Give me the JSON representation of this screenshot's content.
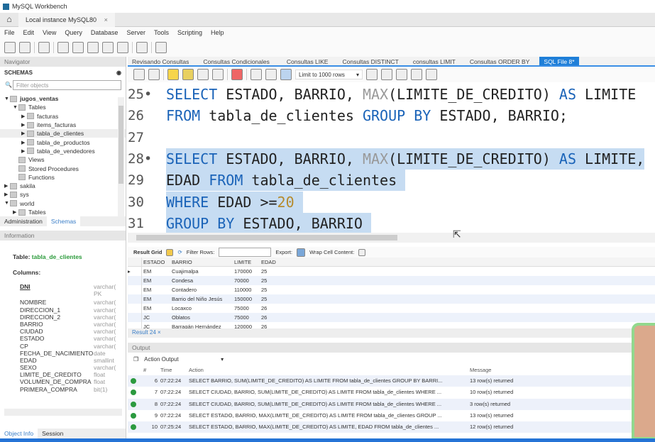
{
  "window": {
    "title": "MySQL Workbench",
    "connection_tab": "Local instance MySQL80",
    "close": "×",
    "home": "⌂"
  },
  "menu": [
    "File",
    "Edit",
    "View",
    "Query",
    "Database",
    "Server",
    "Tools",
    "Scripting",
    "Help"
  ],
  "navigator": {
    "header": "Navigator",
    "schemas_title": "SCHEMAS",
    "filter_placeholder": "Filter objects",
    "tree": [
      {
        "label": "jugos_ventas",
        "level": 0,
        "arrow": "▼",
        "bold": true
      },
      {
        "label": "Tables",
        "level": 1,
        "arrow": "▼"
      },
      {
        "label": "facturas",
        "level": 2,
        "arrow": "▶"
      },
      {
        "label": "items_facturas",
        "level": 2,
        "arrow": "▶"
      },
      {
        "label": "tabla_de_clientes",
        "level": 2,
        "arrow": "▶",
        "selected": true
      },
      {
        "label": "tabla_de_productos",
        "level": 2,
        "arrow": "▶"
      },
      {
        "label": "tabla_de_vendedores",
        "level": 2,
        "arrow": "▶"
      },
      {
        "label": "Views",
        "level": 1,
        "arrow": ""
      },
      {
        "label": "Stored Procedures",
        "level": 1,
        "arrow": ""
      },
      {
        "label": "Functions",
        "level": 1,
        "arrow": ""
      },
      {
        "label": "sakila",
        "level": 0,
        "arrow": "▶"
      },
      {
        "label": "sys",
        "level": 0,
        "arrow": "▶"
      },
      {
        "label": "world",
        "level": 0,
        "arrow": "▼"
      },
      {
        "label": "Tables",
        "level": 1,
        "arrow": "▶"
      }
    ],
    "tabs": [
      "Administration",
      "Schemas"
    ],
    "info_header": "Information",
    "table_label": "Table:",
    "table_name": "tabla_de_clientes",
    "columns_label": "Columns:",
    "columns": [
      [
        "DNI",
        "varchar("
      ],
      [
        "",
        "PK"
      ],
      [
        "NOMBRE",
        "varchar("
      ],
      [
        "DIRECCION_1",
        "varchar("
      ],
      [
        "DIRECCION_2",
        "varchar("
      ],
      [
        "BARRIO",
        "varchar("
      ],
      [
        "CIUDAD",
        "varchar("
      ],
      [
        "ESTADO",
        "varchar("
      ],
      [
        "CP",
        "varchar("
      ],
      [
        "FECHA_DE_NACIMIENTO",
        "date"
      ],
      [
        "EDAD",
        "smallint"
      ],
      [
        "SEXO",
        "varchar("
      ],
      [
        "LIMITE_DE_CREDITO",
        "float"
      ],
      [
        "VOLUMEN_DE_COMPRA",
        "float"
      ],
      [
        "PRIMERA_COMPRA",
        "bit(1)"
      ]
    ],
    "bottom_tabs": [
      "Object Info",
      "Session"
    ]
  },
  "sql_tabs": [
    "Revisando Consultas",
    "Consultas Condicionales",
    "Consultas LIKE",
    "Consultas DISTINCT",
    "consultas LIMIT",
    "Consultas ORDER BY",
    "SQL File 8*"
  ],
  "limit_select": "Limit to 1000 rows",
  "editor": {
    "lines": [
      {
        "n": "25",
        "dot": true,
        "sel": false,
        "t": [
          [
            "kw",
            "SELECT"
          ],
          [
            "id",
            " ESTADO, BARRIO, "
          ],
          [
            "fn",
            "MAX"
          ],
          [
            "id",
            "(LIMITE_DE_CREDITO) "
          ],
          [
            "kw",
            "AS"
          ],
          [
            "id",
            " LIMITE"
          ]
        ]
      },
      {
        "n": "26",
        "dot": false,
        "sel": false,
        "t": [
          [
            "kw",
            "FROM"
          ],
          [
            "id",
            " tabla_de_clientes "
          ],
          [
            "kw",
            "GROUP BY"
          ],
          [
            "id",
            " ESTADO, BARRIO;"
          ]
        ]
      },
      {
        "n": "27",
        "dot": false,
        "sel": false,
        "t": []
      },
      {
        "n": "28",
        "dot": true,
        "sel": true,
        "t": [
          [
            "kw",
            "SELECT"
          ],
          [
            "id",
            " ESTADO, BARRIO, "
          ],
          [
            "fn",
            "MAX"
          ],
          [
            "id",
            "(LIMITE_DE_CREDITO) "
          ],
          [
            "kw",
            "AS"
          ],
          [
            "id",
            " LIMITE,"
          ]
        ]
      },
      {
        "n": "29",
        "dot": false,
        "sel": true,
        "t": [
          [
            "id",
            "EDAD "
          ],
          [
            "kw",
            "FROM"
          ],
          [
            "id",
            " tabla_de_clientes "
          ]
        ]
      },
      {
        "n": "30",
        "dot": false,
        "sel": true,
        "t": [
          [
            "kw",
            "WHERE"
          ],
          [
            "id",
            " EDAD >="
          ],
          [
            "nm",
            "20"
          ],
          [
            "id",
            " "
          ]
        ]
      },
      {
        "n": "31",
        "dot": false,
        "sel": true,
        "t": [
          [
            "kw",
            "GROUP BY"
          ],
          [
            "id",
            " ESTADO, BARRIO "
          ]
        ]
      }
    ]
  },
  "result_toolbar": {
    "grid": "Result Grid",
    "filter": "Filter Rows:",
    "export": "Export:",
    "wrap": "Wrap Cell Content:"
  },
  "grid": {
    "headers": [
      "ESTADO",
      "BARRIO",
      "LIMITE",
      "EDAD"
    ],
    "rows": [
      [
        "EM",
        "Cuajimalpa",
        "170000",
        "25"
      ],
      [
        "EM",
        "Condesa",
        "70000",
        "25"
      ],
      [
        "EM",
        "Contadero",
        "110000",
        "25"
      ],
      [
        "EM",
        "Barrio del Niño Jesús",
        "150000",
        "25"
      ],
      [
        "EM",
        "Locaxco",
        "75000",
        "26"
      ],
      [
        "JC",
        "Oblatos",
        "75000",
        "26"
      ],
      [
        "JC",
        "Barragán Hernández",
        "120000",
        "26"
      ]
    ]
  },
  "result_tab": "Result 24 ×",
  "output": {
    "header": "Output",
    "selector": "Action Output",
    "headers": [
      "#",
      "Time",
      "Action",
      "Message"
    ],
    "rows": [
      [
        "6",
        "07:22:24",
        "SELECT BARRIO, SUM(LIMITE_DE_CREDITO) AS LIMITE  FROM tabla_de_clientes GROUP BY BARRI...",
        "13 row(s) returned"
      ],
      [
        "7",
        "07:22:24",
        "SELECT CIUDAD, BARRIO, SUM(LIMITE_DE_CREDITO) AS LIMITE  FROM tabla_de_clientes WHERE ...",
        "10 row(s) returned"
      ],
      [
        "8",
        "07:22:24",
        "SELECT CIUDAD, BARRIO, SUM(LIMITE_DE_CREDITO) AS LIMITE  FROM tabla_de_clientes WHERE ...",
        "3 row(s) returned"
      ],
      [
        "9",
        "07:22:24",
        "SELECT ESTADO, BARRIO, MAX(LIMITE_DE_CREDITO) AS LIMITE  FROM tabla_de_clientes GROUP ...",
        "13 row(s) returned"
      ],
      [
        "10",
        "07:25:24",
        "SELECT ESTADO, BARRIO, MAX(LIMITE_DE_CREDITO) AS LIMITE, EDAD FROM tabla_de_clientes  ...",
        "12 row(s) returned"
      ]
    ]
  },
  "colors": {
    "accent": "#1f7fd8",
    "keyword": "#1a63b8",
    "selection": "#c6dcf2",
    "ok": "#2b9a3f"
  }
}
